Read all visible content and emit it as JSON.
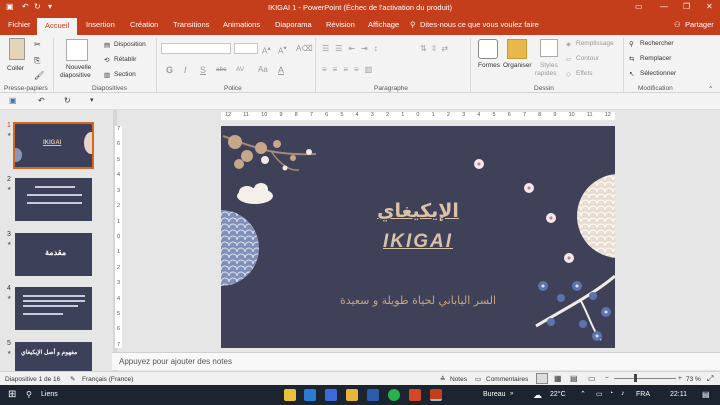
{
  "window": {
    "title": "IKIGAI 1 - PowerPoint (Échec de l'activation du produit)",
    "share": "Partager",
    "share_icon": "person-icon"
  },
  "tabs": [
    "Fichier",
    "Accueil",
    "Insertion",
    "Création",
    "Transitions",
    "Animations",
    "Diaporama",
    "Révision",
    "Affichage"
  ],
  "tell_me": "Dites-nous ce que vous voulez faire",
  "ribbon": {
    "paste": "Coller",
    "new_slide_1": "Nouvelle",
    "new_slide_2": "diapositive",
    "layout": "Disposition",
    "reset": "Rétablir",
    "section": "Section",
    "shapes": "Formes",
    "arrange": "Organiser",
    "styles_1": "Styles",
    "styles_2": "rapides",
    "fill": "Remplissage",
    "outline": "Contour",
    "effects": "Effets",
    "find": "Rechercher",
    "replace": "Remplacer",
    "select": "Sélectionner",
    "groups": {
      "clipboard": "Presse-papiers",
      "slides": "Diapositives",
      "font": "Police",
      "paragraph": "Paragraphe",
      "drawing": "Dessin",
      "editing": "Modification"
    },
    "font_buttons": [
      "G",
      "I",
      "S",
      "abc",
      "AV",
      "Aa",
      "A"
    ]
  },
  "ruler_h": [
    "12",
    "11",
    "10",
    "9",
    "8",
    "7",
    "6",
    "5",
    "4",
    "3",
    "2",
    "1",
    "0",
    "1",
    "2",
    "3",
    "4",
    "5",
    "6",
    "7",
    "8",
    "9",
    "10",
    "11",
    "12"
  ],
  "ruler_v": [
    "7",
    "6",
    "5",
    "4",
    "3",
    "2",
    "1",
    "0",
    "1",
    "2",
    "3",
    "4",
    "5",
    "6",
    "7"
  ],
  "thumbnails": [
    {
      "num": "1",
      "title": "IKIGAI"
    },
    {
      "num": "2",
      "title": ""
    },
    {
      "num": "3",
      "title": "مقدمة"
    },
    {
      "num": "4",
      "title": ""
    },
    {
      "num": "5",
      "title": "مفهوم و أصل الإيكيغاي"
    }
  ],
  "slide": {
    "title_ar": "الإيكيغاي",
    "title_en": "IKIGAI",
    "subtitle_ar": "السر الياباني لحياة طويلة و سعيدة"
  },
  "notes_placeholder": "Appuyez pour ajouter des notes",
  "status": {
    "slide_of": "Diapositive 1 de 16",
    "language": "Français (France)",
    "notes": "Notes",
    "comments": "Commentaires",
    "zoom": "73 %"
  },
  "taskbar": {
    "search": "Liens",
    "desktop": "Bureau",
    "weather": "22°C",
    "lang": "FRA",
    "time": "22:11"
  },
  "colors": {
    "accent": "#c43e1c",
    "slide_bg": "#3e4158",
    "title_color": "#d9c2a8"
  }
}
